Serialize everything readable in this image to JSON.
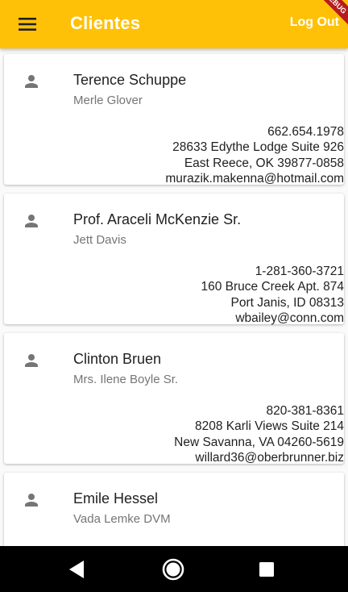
{
  "appbar": {
    "title": "Clientes",
    "logout_label": "Log Out",
    "menu_icon": "menu-icon",
    "color": "#ffc107"
  },
  "debug_banner": "DEBUG",
  "clients": [
    {
      "name": "Terence Schuppe",
      "contact": "Merle Glover",
      "phone": "662.654.1978",
      "address1": "28633 Edythe Lodge Suite 926",
      "address2": "East Reece, OK 39877-0858",
      "email": "murazik.makenna@hotmail.com"
    },
    {
      "name": "Prof. Araceli McKenzie Sr.",
      "contact": "Jett Davis",
      "phone": "1-281-360-3721",
      "address1": "160 Bruce Creek Apt. 874",
      "address2": "Port Janis, ID 08313",
      "email": "wbailey@conn.com"
    },
    {
      "name": "Clinton Bruen",
      "contact": "Mrs. Ilene Boyle Sr.",
      "phone": "820-381-8361",
      "address1": "8208 Karli Views Suite 214",
      "address2": "New Savanna, VA 04260-5619",
      "email": "willard36@oberbrunner.biz"
    },
    {
      "name": "Emile Hessel",
      "contact": "Vada Lemke DVM",
      "phone": "",
      "address1": "",
      "address2": "",
      "email": ""
    }
  ],
  "navbar": {
    "back_icon": "back-icon",
    "home_icon": "home-icon",
    "recents_icon": "recents-icon"
  }
}
